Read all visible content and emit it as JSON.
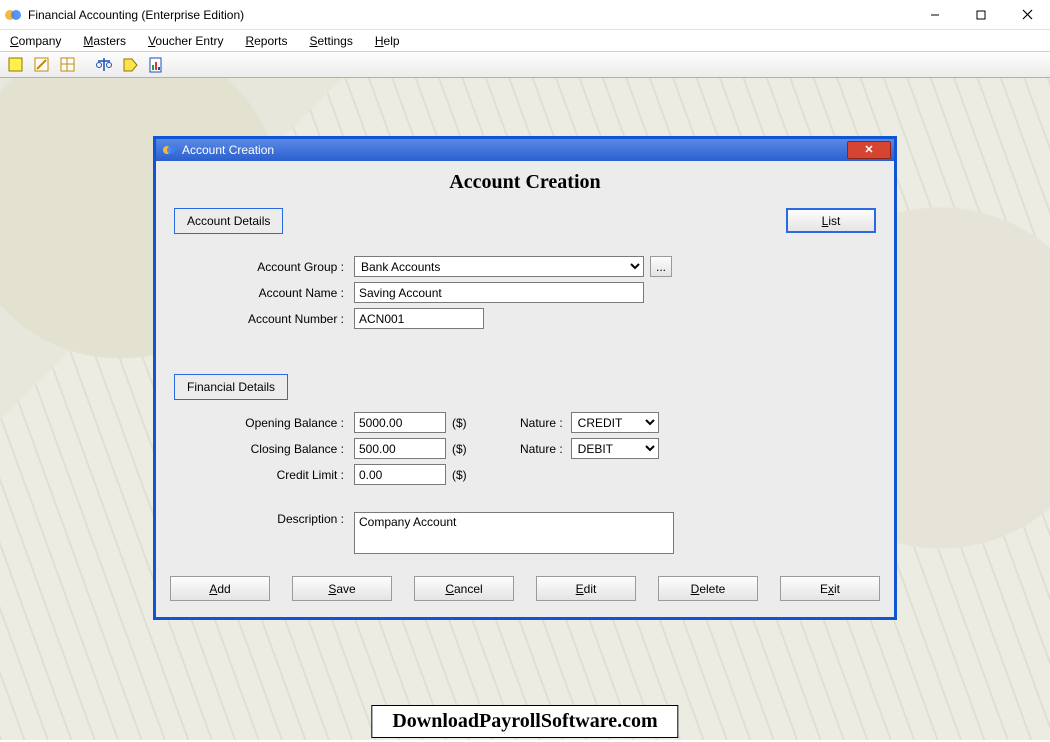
{
  "window": {
    "title": "Financial Accounting (Enterprise Edition)"
  },
  "menu": {
    "company": "Company",
    "masters": "Masters",
    "voucher": "Voucher Entry",
    "reports": "Reports",
    "settings": "Settings",
    "help": "Help"
  },
  "dialog": {
    "title": "Account Creation",
    "heading": "Account Creation",
    "section_account": "Account Details",
    "section_financial": "Financial Details",
    "list_btn": "List",
    "labels": {
      "account_group": "Account Group :",
      "account_name": "Account Name :",
      "account_number": "Account Number :",
      "opening_balance": "Opening Balance :",
      "closing_balance": "Closing Balance :",
      "credit_limit": "Credit Limit :",
      "nature": "Nature :",
      "description": "Description :",
      "currency_unit": "($)"
    },
    "values": {
      "account_group": "Bank Accounts",
      "account_name": "Saving Account",
      "account_number": "ACN001",
      "opening_balance": "5000.00",
      "closing_balance": "500.00",
      "credit_limit": "0.00",
      "nature_open": "CREDIT",
      "nature_close": "DEBIT",
      "description": "Company Account"
    },
    "buttons": {
      "add": "Add",
      "save": "Save",
      "cancel": "Cancel",
      "edit": "Edit",
      "delete": "Delete",
      "exit": "Exit",
      "ellipsis": "..."
    }
  },
  "footer": {
    "banner": "DownloadPayrollSoftware.com"
  }
}
